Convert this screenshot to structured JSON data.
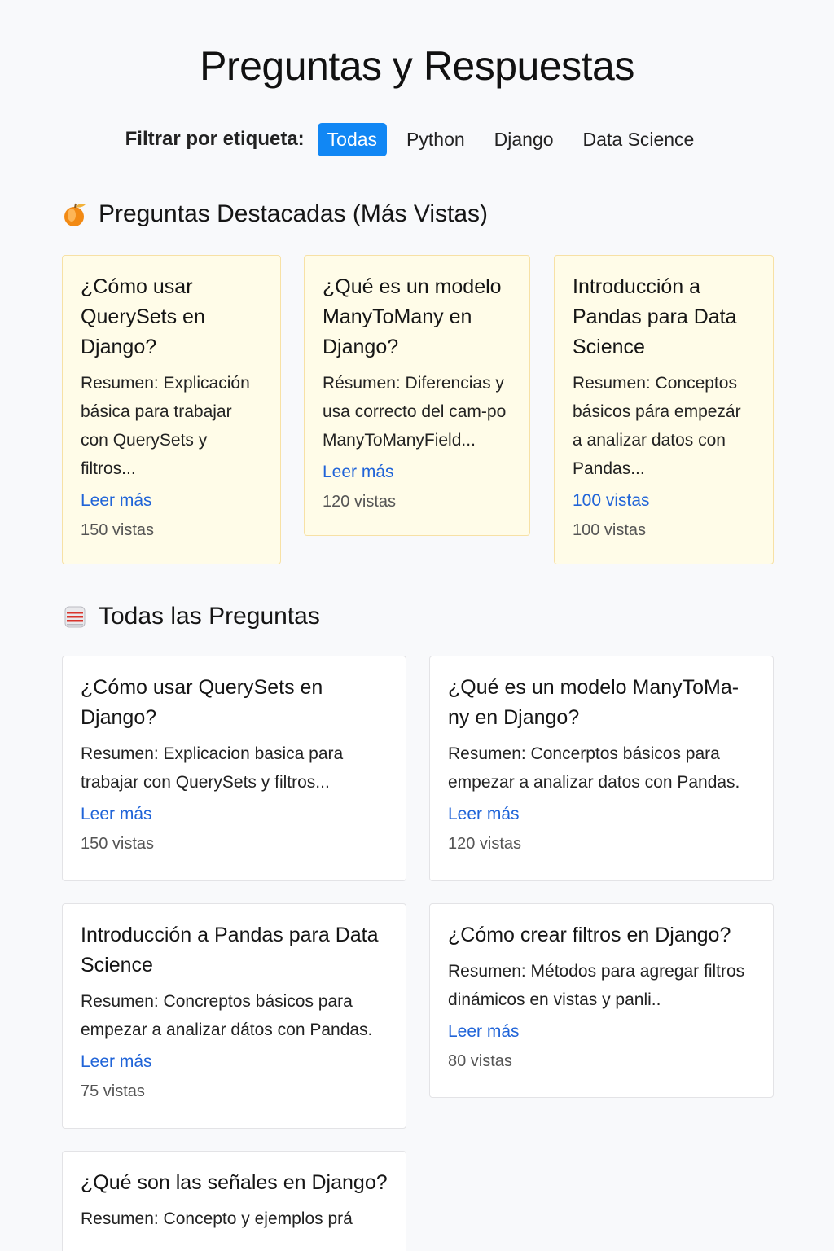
{
  "header": {
    "title": "Preguntas y Respuestas"
  },
  "filter": {
    "label": "Filtrar por etiqueta:",
    "chips": [
      "Todas",
      "Python",
      "Django",
      "Data Science"
    ],
    "active": "Todas",
    "active_color": "#1187f4"
  },
  "featured": {
    "icon": "peach-icon",
    "title": "Preguntas Destacadas (Más Vistas)",
    "cards": [
      {
        "title": "¿Cómo usar QuerySets en Django?",
        "summary": "Resumen: Explicación básica para trabajar con QuerySets y filtros...",
        "link": "Leer más",
        "views": "150 vistas"
      },
      {
        "title": "¿Qué es un modelo ManyToMany en Django?",
        "summary": "Résumen: Diferencias y usa correcto del cam-po ManyToManyField...",
        "link": "Leer más",
        "views": "120 vistas"
      },
      {
        "title": "Introducción a Pandas para Data Science",
        "summary": "Resumen: Conceptos básicos pára empezár a analizar datos con Pandas...",
        "link": "100 vistas",
        "views": "100 vistas"
      }
    ]
  },
  "all": {
    "icon": "stacked-list-icon",
    "title": "Todas las Preguntas",
    "cards": [
      {
        "title": "¿Cómo usar QuerySets en Django?",
        "summary": "Resumen: Explicacion basica para trabajar con QuerySets y filtros...",
        "link": "Leer más",
        "views": "150 vistas"
      },
      {
        "title": "¿Qué es un modelo ManyToMa-ny en Django?",
        "summary": "Resumen: Concerptos básicos para empezar a analizar datos con Pandas.",
        "link": "Leer más",
        "views": "120 vistas"
      },
      {
        "title": "Introducción a Pandas para Data Science",
        "summary": "Resumen: Concreptos básicos para empezar a analizar dátos con Pandas.",
        "link": "Leer más",
        "views": "75 vistas"
      },
      {
        "title": "¿Cómo crear filtros en Django?",
        "summary": "Resumen: Métodos para agregar filtros dinámicos en vistas y panli..",
        "link": "Leer más",
        "views": "80 vistas"
      },
      {
        "title": "¿Qué son las señales en Django?",
        "summary": "Resumen: Concepto y ejemplos prá"
      }
    ]
  }
}
